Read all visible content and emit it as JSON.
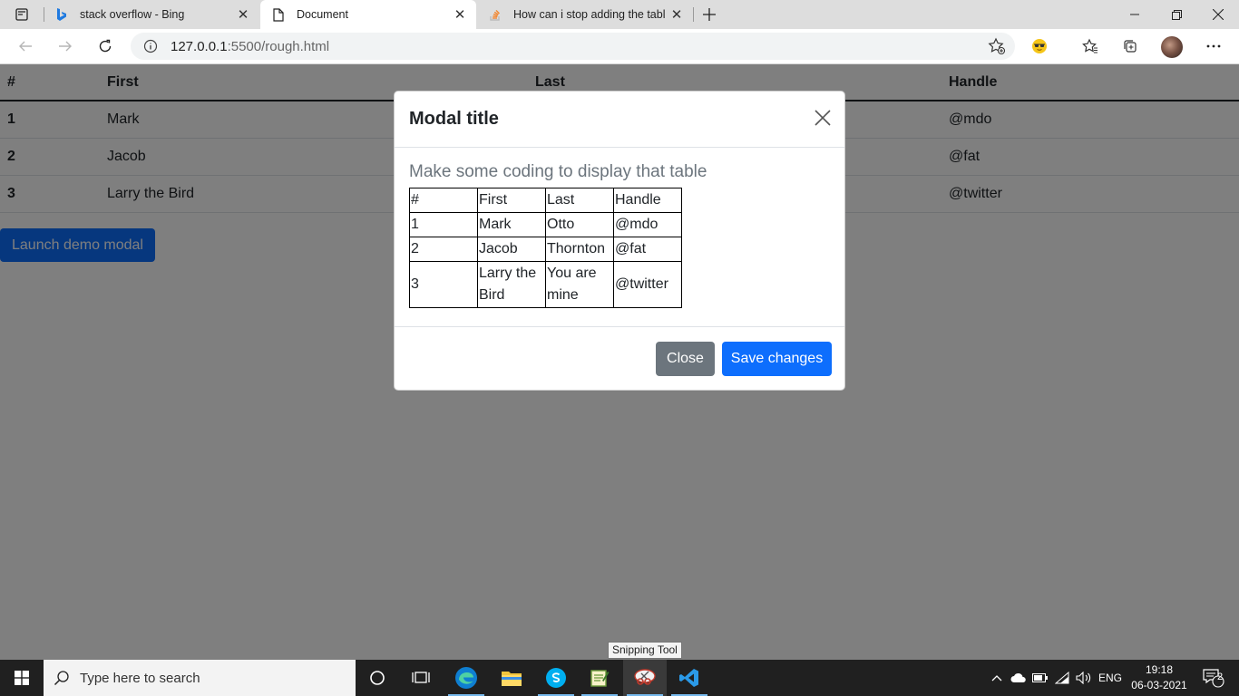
{
  "browser": {
    "tabs": [
      {
        "title": "stack overflow - Bing",
        "favicon": "bing-icon"
      },
      {
        "title": "Document",
        "favicon": "document-icon"
      },
      {
        "title": "How can i stop adding the table",
        "favicon": "stackoverflow-icon"
      }
    ],
    "address": {
      "host": "127.0.0.1",
      "path": ":5500/rough.html"
    }
  },
  "page": {
    "table": {
      "headers": [
        "#",
        "First",
        "Last",
        "Handle"
      ],
      "rows": [
        {
          "num": "1",
          "first": "Mark",
          "handle": "@mdo"
        },
        {
          "num": "2",
          "first": "Jacob",
          "handle": "@fat"
        },
        {
          "num": "3",
          "first": "Larry the Bird",
          "handle": "@twitter"
        }
      ]
    },
    "launch_button": "Launch demo modal"
  },
  "modal": {
    "title": "Modal title",
    "lead": "Make some coding to display that table",
    "table": [
      [
        "#",
        "First",
        "Last",
        "Handle"
      ],
      [
        "1",
        "Mark",
        "Otto",
        "@mdo"
      ],
      [
        "2",
        "Jacob",
        "Thornton",
        "@fat"
      ],
      [
        "3",
        "Larry the Bird",
        "You are mine",
        "@twitter"
      ]
    ],
    "close_label": "Close",
    "save_label": "Save changes"
  },
  "tooltip": "Snipping Tool",
  "taskbar": {
    "search_placeholder": "Type here to search",
    "language": "ENG",
    "time": "19:18",
    "date": "06-03-2021",
    "notification_count": "2"
  },
  "colors": {
    "primary": "#0d6efd",
    "secondary": "#6c757d",
    "taskbar": "#202020"
  }
}
